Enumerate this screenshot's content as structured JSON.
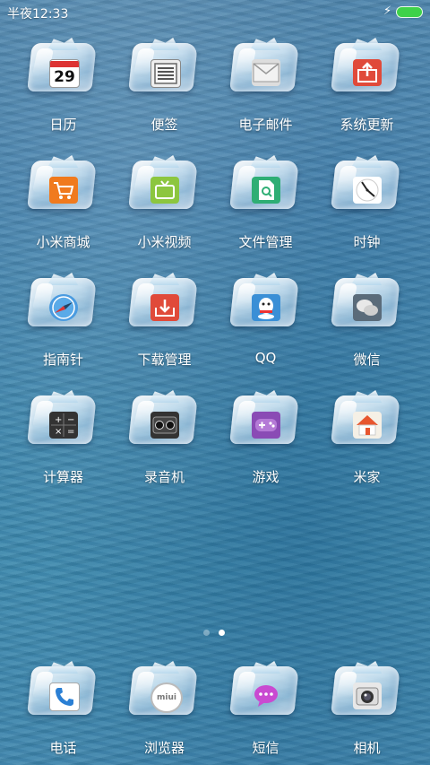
{
  "status_bar": {
    "time": "半夜12:33",
    "charging_icon": "lightning-icon",
    "battery_icon": "battery-full-icon",
    "battery_color": "#3ed24a"
  },
  "apps": [
    {
      "label": "日历",
      "icon": "calendar-icon",
      "badge_text": "29"
    },
    {
      "label": "便签",
      "icon": "notes-icon"
    },
    {
      "label": "电子邮件",
      "icon": "email-icon"
    },
    {
      "label": "系统更新",
      "icon": "system-update-icon"
    },
    {
      "label": "小米商城",
      "icon": "shopping-cart-icon"
    },
    {
      "label": "小米视频",
      "icon": "tv-icon"
    },
    {
      "label": "文件管理",
      "icon": "file-manager-icon"
    },
    {
      "label": "时钟",
      "icon": "clock-icon"
    },
    {
      "label": "指南针",
      "icon": "compass-icon"
    },
    {
      "label": "下载管理",
      "icon": "download-icon"
    },
    {
      "label": "QQ",
      "icon": "qq-icon"
    },
    {
      "label": "微信",
      "icon": "wechat-icon"
    },
    {
      "label": "计算器",
      "icon": "calculator-icon"
    },
    {
      "label": "录音机",
      "icon": "recorder-icon"
    },
    {
      "label": "游戏",
      "icon": "gamepad-icon"
    },
    {
      "label": "米家",
      "icon": "home-icon"
    }
  ],
  "page_indicator": {
    "pages": 2,
    "current": 2
  },
  "dock": [
    {
      "label": "电话",
      "icon": "phone-icon"
    },
    {
      "label": "浏览器",
      "icon": "browser-icon",
      "badge_text": "miui"
    },
    {
      "label": "短信",
      "icon": "sms-icon"
    },
    {
      "label": "相机",
      "icon": "camera-icon"
    }
  ]
}
